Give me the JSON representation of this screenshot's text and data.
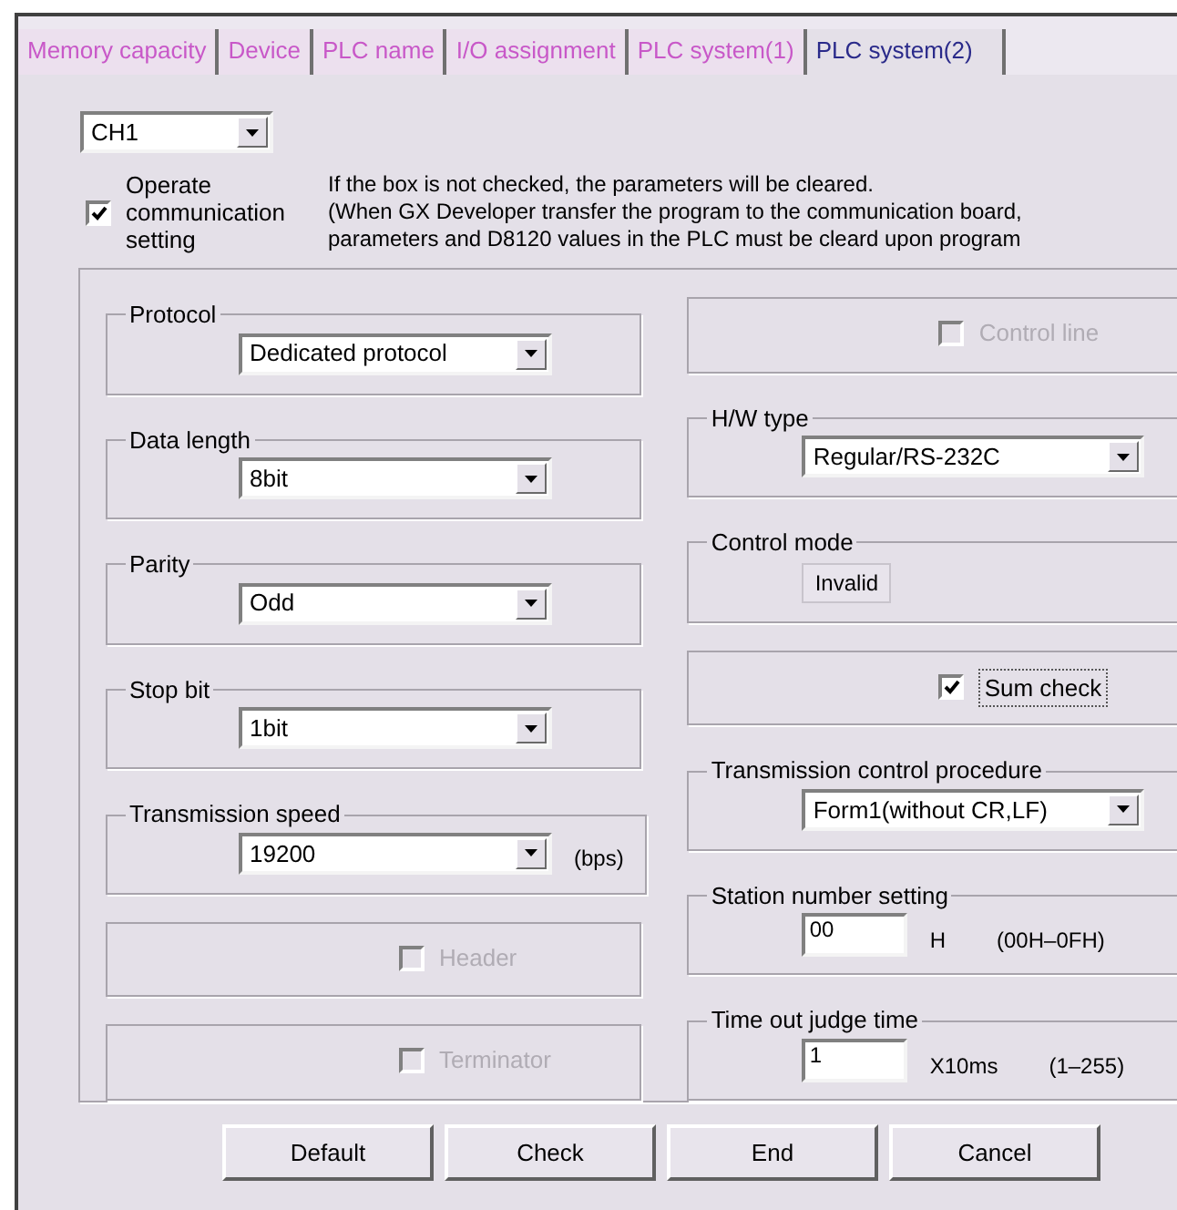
{
  "tabs": [
    {
      "label": "Memory capacity",
      "selected": false
    },
    {
      "label": "Device",
      "selected": false
    },
    {
      "label": "PLC name",
      "selected": false
    },
    {
      "label": "I/O assignment",
      "selected": false
    },
    {
      "label": "PLC system(1)",
      "selected": false
    },
    {
      "label": "PLC system(2)",
      "selected": true
    }
  ],
  "channel_select": {
    "value": "CH1"
  },
  "operate": {
    "label": "Operate communication setting",
    "checked": true
  },
  "notice": [
    "If the box is not checked, the parameters will be cleared.",
    "(When GX Developer transfer the program to the communication board,",
    "parameters and D8120 values in the PLC must be cleard upon program"
  ],
  "left_groups": [
    {
      "kind": "select",
      "legend": "Protocol",
      "value": "Dedicated protocol"
    },
    {
      "kind": "select",
      "legend": "Data length",
      "value": "8bit"
    },
    {
      "kind": "select",
      "legend": "Parity",
      "value": "Odd"
    },
    {
      "kind": "select",
      "legend": "Stop bit",
      "value": "1bit"
    },
    {
      "kind": "select",
      "legend": "Transmission speed",
      "value": "19200",
      "unit": "(bps)"
    },
    {
      "kind": "checkbox",
      "label": "Header",
      "checked": false,
      "disabled": true
    },
    {
      "kind": "checkbox",
      "label": "Terminator",
      "checked": false,
      "disabled": true
    }
  ],
  "right_groups": [
    {
      "kind": "checkbox",
      "label": "Control line",
      "checked": false,
      "disabled": true
    },
    {
      "kind": "select",
      "legend": "H/W type",
      "value": "Regular/RS-232C"
    },
    {
      "kind": "readout",
      "legend": "Control mode",
      "value": "Invalid"
    },
    {
      "kind": "checkbox",
      "label": "Sum check",
      "checked": true,
      "disabled": false
    },
    {
      "kind": "select",
      "legend": "Transmission control procedure",
      "value": "Form1(without CR,LF)"
    },
    {
      "kind": "input",
      "legend": "Station number setting",
      "value": "00",
      "unit": "H",
      "range": "(00H–0FH)"
    },
    {
      "kind": "input",
      "legend": "Time out judge time",
      "value": "1",
      "unit": "X10ms",
      "range": "(1–255)"
    }
  ],
  "buttons": [
    "Default",
    "Check",
    "End",
    "Cancel"
  ]
}
